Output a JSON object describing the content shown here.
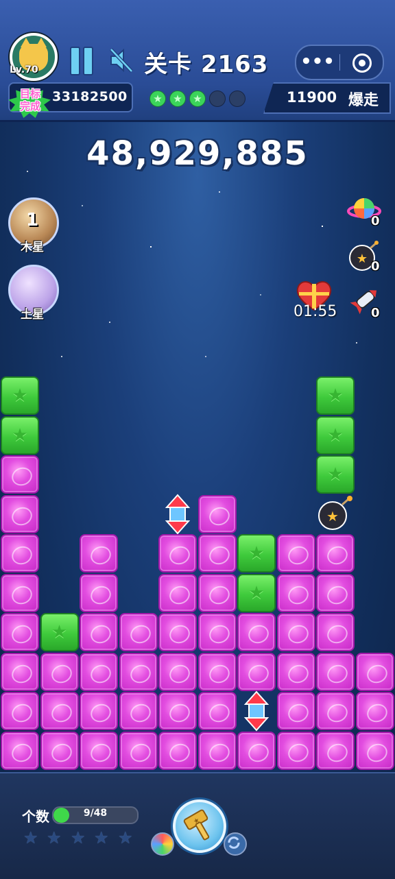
{
  "header": {
    "player_level": "Lv.70",
    "level_title": "关卡 2163",
    "more_label": "•••",
    "goal_badge": "目标\n完成",
    "goal_score": "33182500",
    "stars_earned": 3,
    "stars_total": 5,
    "right_score": "11900",
    "right_label": "爆走"
  },
  "score": "48,929,885",
  "planets": [
    {
      "name": "木星",
      "count": "1"
    },
    {
      "name": "土星",
      "count": ""
    }
  ],
  "tools": {
    "rainbow_count": "0",
    "bomb_count": "0",
    "rocket_count": "0",
    "gift_timer": "01:55"
  },
  "board": {
    "rows": [
      "G.......G.",
      "G.......G.",
      "P.......G.",
      "P...AP..B.",
      "P.P.PPGPP.",
      "P.P.PPGPP.",
      "PGPPPPPPP.",
      "PPPPPPPPPP",
      "PPPPPPAPPP",
      "PPPPPPPPPP"
    ],
    "legend": {
      "P": "pink-planet-block",
      "G": "green-star-block",
      "A": "arrow-booster",
      "B": "bomb-booster",
      ".": "empty"
    }
  },
  "footer": {
    "count_label": "个数",
    "progress_text": "9/48",
    "progress_value": 9,
    "progress_max": 48,
    "star_slots": 5
  },
  "colors": {
    "pink": "#e24de0",
    "green": "#3fca3c",
    "accent": "#6ed0f2"
  }
}
